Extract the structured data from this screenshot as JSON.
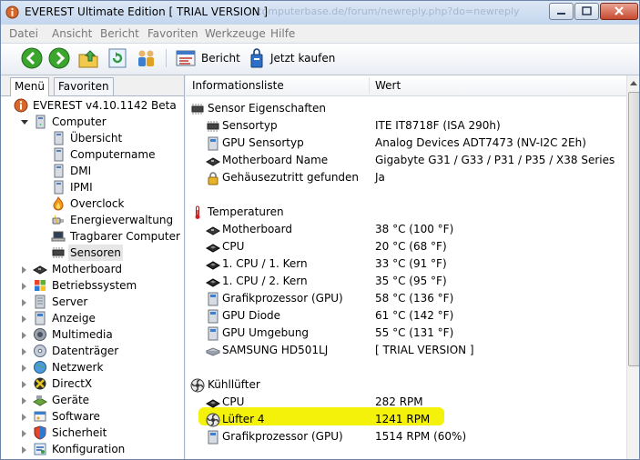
{
  "window": {
    "title": "EVEREST Ultimate Edition  [ TRIAL VERSION ]",
    "background_ghost_text": "...computerbase.de/forum/newreply.php?do=newreply&noquote..."
  },
  "menu": [
    "Datei",
    "Ansicht",
    "Bericht",
    "Favoriten",
    "Werkzeuge",
    "Hilfe"
  ],
  "toolbar": {
    "icons": [
      "back-icon",
      "forward-icon",
      "up-folder-icon",
      "refresh-icon",
      "users-icon",
      "report-icon",
      "buy-icon"
    ],
    "report_label": "Bericht",
    "buy_label": "Jetzt kaufen"
  },
  "tabs": {
    "menu": "Menü",
    "favorites": "Favoriten"
  },
  "tree": {
    "root": "EVEREST v4.10.1142 Beta",
    "computer": "Computer",
    "computer_children": [
      "Übersicht",
      "Computername",
      "DMI",
      "IPMI",
      "Overclock",
      "Energieverwaltung",
      "Tragbarer Computer",
      "Sensoren"
    ],
    "top_items": [
      "Motherboard",
      "Betriebssystem",
      "Server",
      "Anzeige",
      "Multimedia",
      "Datenträger",
      "Netzwerk",
      "DirectX",
      "Geräte",
      "Software",
      "Sicherheit",
      "Konfiguration"
    ]
  },
  "table": {
    "col_field": "Informationsliste",
    "col_value": "Wert",
    "sections": [
      {
        "title": "Sensor Eigenschaften",
        "rows": [
          {
            "name": "Sensortyp",
            "value": "ITE IT8718F  (ISA 290h)"
          },
          {
            "name": "GPU Sensortyp",
            "value": "Analog Devices ADT7473  (NV-I2C 2Eh)"
          },
          {
            "name": "Motherboard Name",
            "value": "Gigabyte G31 / G33 / P31 / P35 / X38 Series"
          },
          {
            "name": "Gehäusezutritt gefunden",
            "value": "Ja"
          }
        ]
      },
      {
        "title": "Temperaturen",
        "rows": [
          {
            "name": "Motherboard",
            "value": "38 °C  (100 °F)"
          },
          {
            "name": "CPU",
            "value": "20 °C  (68 °F)"
          },
          {
            "name": "1. CPU / 1. Kern",
            "value": "33 °C  (91 °F)"
          },
          {
            "name": "1. CPU / 2. Kern",
            "value": "35 °C  (95 °F)"
          },
          {
            "name": "Grafikprozessor (GPU)",
            "value": "58 °C  (136 °F)"
          },
          {
            "name": "GPU Diode",
            "value": "61 °C  (142 °F)"
          },
          {
            "name": "GPU Umgebung",
            "value": "55 °C  (131 °F)"
          },
          {
            "name": "SAMSUNG HD501LJ",
            "value": "[ TRIAL VERSION ]"
          }
        ]
      },
      {
        "title": "Kühllüfter",
        "rows": [
          {
            "name": "CPU",
            "value": "282 RPM"
          },
          {
            "name": "Lüfter 4",
            "value": "1241 RPM"
          },
          {
            "name": "Grafikprozessor (GPU)",
            "value": "1514 RPM  (60%)"
          }
        ]
      }
    ]
  },
  "colors": {
    "highlight": "#f4f20a",
    "title_bar": "#c4d6ee",
    "selected_tree": "#e6e6e6"
  }
}
